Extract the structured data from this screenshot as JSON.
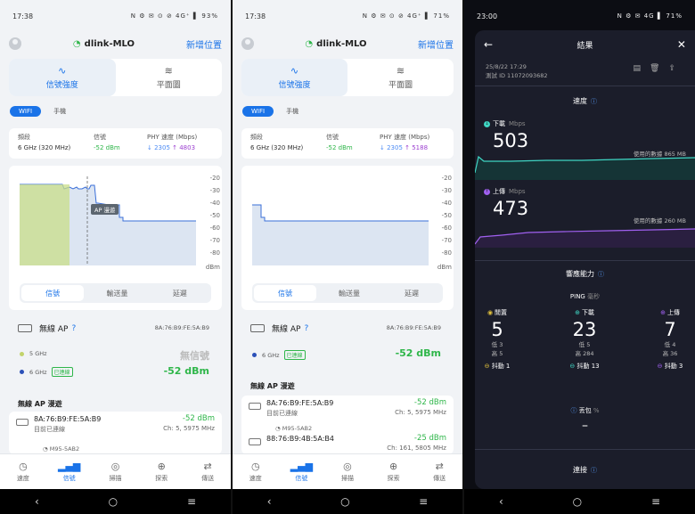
{
  "left": {
    "status": {
      "time": "17:38",
      "right": "N ⚙ ✉ ⊙ ⊘ 4G⁺ ▌ 93%"
    },
    "ssid": "dlink-MLO",
    "add_location": "新增位置",
    "modes": [
      "信號強度",
      "平面圖"
    ],
    "seg": [
      "WIFI",
      "手機"
    ],
    "info_labels": [
      "頻段",
      "信號",
      "PHY 速度 (Mbps)"
    ],
    "band_value": "6 GHz (320 MHz)",
    "signal_value": "-52 dBm",
    "phy_down": "↓ 2305",
    "phy_up": "↑ 4803",
    "y_ticks": [
      "-20",
      "-30",
      "-40",
      "-50",
      "-60",
      "-70",
      "-80",
      "dBm"
    ],
    "roam_tag": "AP 漫遊",
    "chart_tabs": [
      "信號",
      "輸送量",
      "延遲"
    ],
    "ap_title": "無線 AP",
    "ap_mac": "8A:76:B9:FE:5A:B9",
    "band5": "5 GHz",
    "band6": "6 GHz",
    "connected": "已連線",
    "no_signal": "無信號",
    "dbm": "-52 dBm",
    "roam_title": "無線 AP 漫遊",
    "roam_items": [
      {
        "mac": "8A:76:B9:FE:5A:B9",
        "sub": "目前已連線",
        "dbm": "-52 dBm",
        "ch": "Ch: 5, 5975 MHz"
      }
    ],
    "sub_device": "M95-5AB2",
    "nav": [
      "速度",
      "信號",
      "掃描",
      "探索",
      "傳送"
    ]
  },
  "mid": {
    "status": {
      "time": "17:38",
      "right": "N ⚙ ✉ ⊙ ⊘ 4G⁺ ▌ 71%"
    },
    "ssid": "dlink-MLO",
    "add_location": "新增位置",
    "modes": [
      "信號強度",
      "平面圖"
    ],
    "seg": [
      "WIFI",
      "手機"
    ],
    "info_labels": [
      "頻段",
      "信號",
      "PHY 速度 (Mbps)"
    ],
    "band_value": "6 GHz (320 MHz)",
    "signal_value": "-52 dBm",
    "phy_down": "↓ 2305",
    "phy_up": "↑ 5188",
    "y_ticks": [
      "-20",
      "-30",
      "-40",
      "-50",
      "-60",
      "-70",
      "-80",
      "dBm"
    ],
    "chart_tabs": [
      "信號",
      "輸送量",
      "延遲"
    ],
    "ap_title": "無線 AP",
    "ap_mac": "8A:76:B9:FE:5A:B9",
    "band6": "6 GHz",
    "connected": "已連線",
    "dbm": "-52 dBm",
    "roam_title": "無線 AP 漫遊",
    "roam_items": [
      {
        "mac": "8A:76:B9:FE:5A:B9",
        "sub": "目前已連線",
        "dbm": "-52 dBm",
        "ch": "Ch: 5, 5975 MHz"
      },
      {
        "mac": "88:76:B9:4B:5A:B4",
        "sub": "",
        "dbm": "-25 dBm",
        "ch": "Ch: 161, 5805 MHz"
      }
    ],
    "sub_device": "M95-5AB2",
    "nav": [
      "速度",
      "信號",
      "掃描",
      "探索",
      "傳送"
    ]
  },
  "right": {
    "status": {
      "time": "23:00",
      "right": "N ⚙ ✉ 4G ▌ 71%"
    },
    "title": "結果",
    "date": "25/8/22 17:29",
    "test_id": "測試 ID 11072093682",
    "speed_title": "速度",
    "down_label": "下載",
    "unit_mbps": "Mbps",
    "down_value": "503",
    "down_used": "使用的數據 865 MB",
    "up_label": "上傳",
    "up_value": "473",
    "up_used": "使用的數據 260 MB",
    "resp_title": "響應能力",
    "ping_label": "PING",
    "ping_unit": "毫秒",
    "ping_cols": [
      {
        "h": "閒置",
        "n": "5",
        "low": "低 3",
        "high": "高 5",
        "jitter": "抖動 1"
      },
      {
        "h": "下載",
        "n": "23",
        "low": "低 5",
        "high": "高 284",
        "jitter": "抖動 13"
      },
      {
        "h": "上傳",
        "n": "7",
        "low": "低 4",
        "high": "高 36",
        "jitter": "抖動 3"
      }
    ],
    "loss_label": "丟包",
    "loss_unit": "%",
    "loss_value": "–",
    "conn_title": "連接"
  },
  "colors": {
    "accent": "#1a73e8",
    "good": "#2fb64a",
    "download": "#3fd6c4",
    "upload": "#a060f0"
  }
}
